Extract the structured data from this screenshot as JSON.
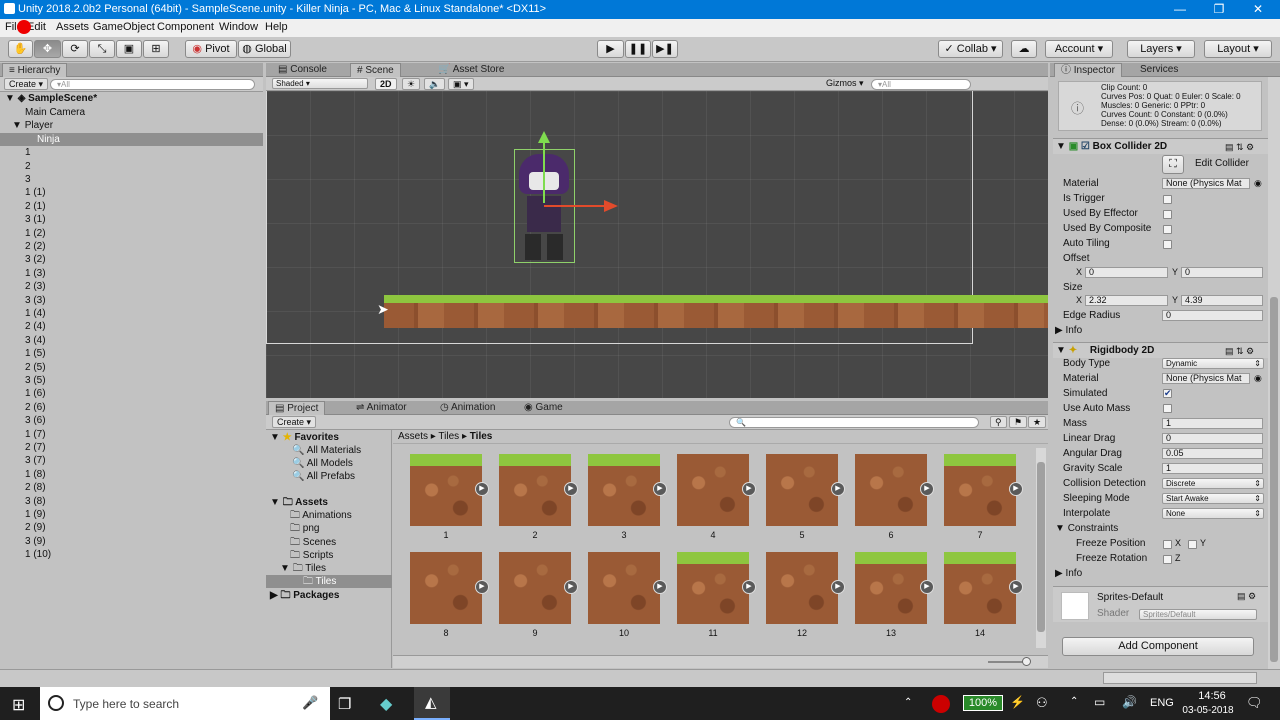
{
  "window": {
    "title": "Unity 2018.2.0b2 Personal (64bit) - SampleScene.unity - Killer Ninja - PC, Mac & Linux Standalone* <DX11>",
    "min": "—",
    "max": "❐",
    "close": "✕"
  },
  "menu": [
    "File",
    "Edit",
    "Assets",
    "GameObject",
    "Component",
    "Window",
    "Help"
  ],
  "toolbar": {
    "pivot": "Pivot",
    "global": "Global",
    "collab": "Collab ▾",
    "account": "Account",
    "layers": "Layers",
    "layout": "Layout",
    "play": "▶",
    "pause": "❚❚",
    "step": "▶❚"
  },
  "hierarchy": {
    "tab": "Hierarchy",
    "create": "Create ▾",
    "search_placeholder": "▾All",
    "scene": "SampleScene*",
    "items": [
      "Main Camera",
      "Player",
      "Ninja",
      "1",
      "2",
      "3",
      "1 (1)",
      "2 (1)",
      "3 (1)",
      "1 (2)",
      "2 (2)",
      "3 (2)",
      "1 (3)",
      "2 (3)",
      "3 (3)",
      "1 (4)",
      "2 (4)",
      "3 (4)",
      "1 (5)",
      "2 (5)",
      "3 (5)",
      "1 (6)",
      "2 (6)",
      "3 (6)",
      "1 (7)",
      "2 (7)",
      "3 (7)",
      "1 (8)",
      "2 (8)",
      "3 (8)",
      "1 (9)",
      "2 (9)",
      "3 (9)",
      "1 (10)"
    ]
  },
  "center_tabs": {
    "console": "Console",
    "scene": "Scene",
    "asset_store": "Asset Store"
  },
  "scene_bar": {
    "shaded": "Shaded",
    "mode2d": "2D",
    "gizmos": "Gizmos ▾",
    "search": "▾All"
  },
  "project_tabs": {
    "project": "Project",
    "animator": "Animator",
    "animation": "Animation",
    "game": "Game"
  },
  "project": {
    "create": "Create ▾",
    "favorites": "Favorites",
    "fav_items": [
      "All Materials",
      "All Models",
      "All Prefabs"
    ],
    "assets": "Assets",
    "asset_items": [
      "Animations",
      "png",
      "Scenes",
      "Scripts",
      "Tiles"
    ],
    "tiles_child": "Tiles",
    "packages": "Packages",
    "breadcrumb": [
      "Assets",
      "Tiles",
      "Tiles"
    ],
    "tiles_row1": [
      "1",
      "2",
      "3",
      "4",
      "5",
      "6",
      "7"
    ],
    "tiles_row2": [
      "8",
      "9",
      "10",
      "11",
      "12",
      "13",
      "14"
    ]
  },
  "inspector": {
    "tab": "Inspector",
    "services": "Services",
    "info_lines": [
      "Clip Count: 0",
      "Curves Pos: 0 Quat: 0 Euler: 0 Scale: 0",
      "Muscles: 0 Generic: 0 PPtr: 0",
      "Curves Count: 0 Constant: 0 (0.0%)",
      "Dense: 0 (0.0%) Stream: 0 (0.0%)"
    ],
    "box_collider": {
      "title": "Box Collider 2D",
      "edit_collider": "Edit Collider",
      "material": "Material",
      "material_val": "None (Physics Mat",
      "is_trigger": "Is Trigger",
      "used_by_effector": "Used By Effector",
      "used_by_composite": "Used By Composite",
      "auto_tiling": "Auto Tiling",
      "offset": "Offset",
      "offset_x": "0",
      "offset_y": "0",
      "size": "Size",
      "size_x": "2.32",
      "size_y": "4.39",
      "edge_radius": "Edge Radius",
      "edge_val": "0",
      "info": "Info",
      "x": "X",
      "y": "Y"
    },
    "rigidbody": {
      "title": "Rigidbody 2D",
      "body_type": "Body Type",
      "body_type_val": "Dynamic",
      "material": "Material",
      "material_val": "None (Physics Mat",
      "simulated": "Simulated",
      "use_auto_mass": "Use Auto Mass",
      "mass": "Mass",
      "mass_val": "1",
      "linear_drag": "Linear Drag",
      "linear_val": "0",
      "angular_drag": "Angular Drag",
      "angular_val": "0.05",
      "gravity_scale": "Gravity Scale",
      "gravity_val": "1",
      "collision": "Collision Detection",
      "collision_val": "Discrete",
      "sleeping": "Sleeping Mode",
      "sleeping_val": "Start Awake",
      "interpolate": "Interpolate",
      "interpolate_val": "None",
      "constraints": "Constraints",
      "freeze_pos": "Freeze Position",
      "freeze_rot": "Freeze Rotation",
      "x": "X",
      "y": "Y",
      "z": "Z",
      "info": "Info"
    },
    "sprite": {
      "name": "Sprites-Default",
      "shader": "Shader",
      "shader_val": "Sprites/Default"
    },
    "add_component": "Add Component"
  },
  "taskbar": {
    "search": "Type here to search",
    "battery": "100%",
    "lang": "ENG",
    "time": "14:56",
    "date": "03-05-2018"
  },
  "colors": {
    "title_bg": "#0078d7",
    "grass": "#8ec63f",
    "dirt": "#9a5a35",
    "scene_bg": "#474747"
  }
}
